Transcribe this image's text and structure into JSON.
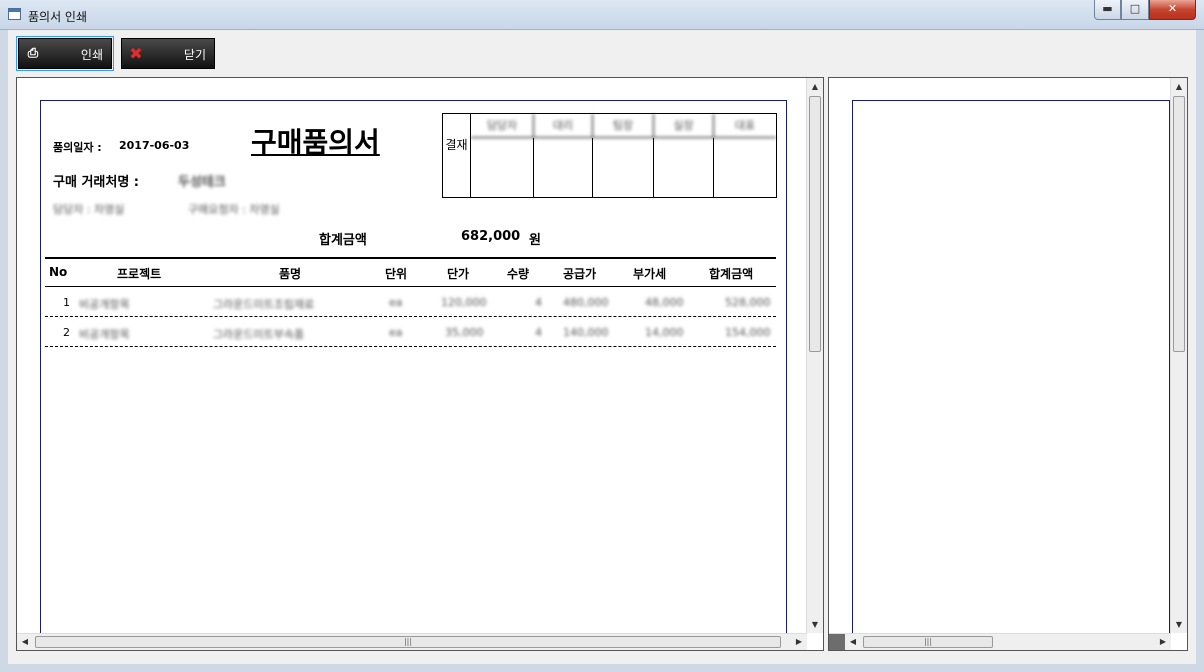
{
  "window": {
    "title": "품의서 인쇄"
  },
  "toolbar": {
    "print_label": "인쇄",
    "close_label": "닫기"
  },
  "doc": {
    "date_label": "품의일자 :",
    "date_value": "2017-06-03",
    "title": "구매품의서",
    "vendor_label": "구매 거래처명 :",
    "vendor_value": "두성테크",
    "requester": "담당자 : 차영실",
    "dept": "구매요청자 : 차영실",
    "approval_label": "결재",
    "approvers": [
      "담당자",
      "대리",
      "팀장",
      "실장",
      "대표"
    ],
    "total_label": "합계금액",
    "total_value": "682,000",
    "total_unit": "원",
    "headers": [
      "No",
      "프로젝트",
      "품명",
      "단위",
      "단가",
      "수량",
      "공급가",
      "부가세",
      "합계금액"
    ],
    "rows": [
      {
        "no": "1",
        "project": "비공개항목",
        "item": "그라운드미트조립재료",
        "unit": "ea",
        "price": "120,000",
        "qty": "4",
        "supply": "480,000",
        "vat": "48,000",
        "total": "528,000"
      },
      {
        "no": "2",
        "project": "비공개항목",
        "item": "그라운드미트부속품",
        "unit": "ea",
        "price": "35,000",
        "qty": "4",
        "supply": "140,000",
        "vat": "14,000",
        "total": "154,000"
      }
    ]
  }
}
